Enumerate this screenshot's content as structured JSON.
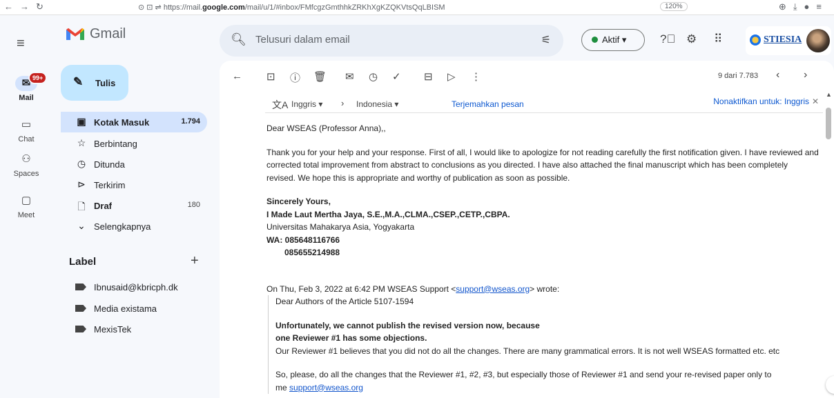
{
  "browser": {
    "url_prefix": "https://mail.",
    "url_domain": "google.com",
    "url_rest": "/mail/u/1/#inbox/FMfcgzGmthhkZRKhXgKZQKVtsQqLBISM",
    "zoom": "120%"
  },
  "rail": {
    "mail_label": "Mail",
    "mail_badge": "99+",
    "chat_label": "Chat",
    "spaces_label": "Spaces",
    "meet_label": "Meet"
  },
  "header": {
    "app_name": "Gmail",
    "search_placeholder": "Telusuri dalam email",
    "status_label": "Aktif",
    "org_name": "STIESIA"
  },
  "sidebar": {
    "compose_label": "Tulis",
    "items": [
      {
        "label": "Kotak Masuk",
        "count": "1.794"
      },
      {
        "label": "Berbintang",
        "count": ""
      },
      {
        "label": "Ditunda",
        "count": ""
      },
      {
        "label": "Terkirim",
        "count": ""
      },
      {
        "label": "Draf",
        "count": "180"
      },
      {
        "label": "Selengkapnya",
        "count": ""
      }
    ],
    "labels_heading": "Label",
    "labels": [
      "Ibnusaid@kbricph.dk",
      "Media existama",
      "MexisTek"
    ]
  },
  "toolbar": {
    "paging": "9 dari 7.783"
  },
  "translate": {
    "source_lang": "Inggris",
    "target_lang": "Indonesia",
    "translate_link": "Terjemahkan pesan",
    "disable_link": "Nonaktifkan untuk: Inggris"
  },
  "email": {
    "greeting": "Dear WSEAS (Professor Anna),,",
    "para1": "Thank you for your help and your response. First of all, I would like to apologize for not reading carefully the first notification given. I have reviewed and corrected total improvement from abstract to conclusions as you directed. I have also attached the final manuscript which has been completely revised. We hope this is appropriate and worthy of publication as soon as possible.",
    "closing": "Sincerely Yours,",
    "name": "I Made Laut Mertha Jaya, S.E.,M.A.,CLMA.,CSEP.,CETP.,CBPA.",
    "affiliation": "Universitas Mahakarya Asia, Yogyakarta",
    "wa1": "WA: 085648116766",
    "wa2": "085655214988",
    "quote_header_pre": "On Thu, Feb 3, 2022 at 6:42 PM WSEAS Support <",
    "quote_email": "support@wseas.org",
    "quote_header_post": "> wrote:",
    "q_greeting": "Dear Authors of the Article  5107-1594",
    "q_bold1": "Unfortunately, we cannot publish the revised version now, because",
    "q_bold2": "one  Reviewer #1  has some objections.",
    "q_line": "Our Reviewer #1 believes that you did not do all the changes. There are many grammatical errors. It is not well WSEAS formatted etc. etc",
    "q_para2": "So, please, do all the changes that the Reviewer #1, #2, #3, but especially those of Reviewer #1 and send your re-revised paper only to",
    "q_me": "me ",
    "q_email2": "support@wseas.org"
  }
}
